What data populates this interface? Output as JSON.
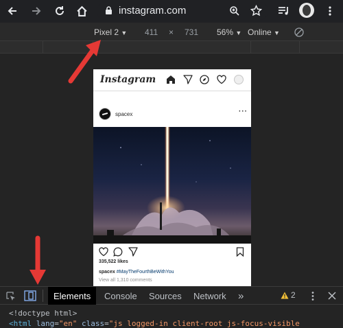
{
  "browser": {
    "url": "instagram.com",
    "colors": {
      "toolbar_bg": "#202124",
      "text": "#e8eaed"
    }
  },
  "device_toolbar": {
    "device": "Pixel 2",
    "width": "411",
    "separator": "×",
    "height": "731",
    "zoom": "56%",
    "network": "Online"
  },
  "instagram": {
    "logo": "Instagram",
    "post": {
      "username": "spacex",
      "more": "···",
      "likes": "335,522 likes",
      "caption_user": "spacex",
      "caption_tag": "#MayTheFourthBeWithYou",
      "comments": "View all 1,310 comments"
    }
  },
  "devtools": {
    "tabs": [
      "Elements",
      "Console",
      "Sources",
      "Network"
    ],
    "more_tabs": "»",
    "warning_count": "2",
    "code_line_1": "<!doctype html>",
    "code_line_2": {
      "tag_open": "<html",
      "attr1": "lang",
      "val1": "\"en\"",
      "attr2": "class",
      "val2": "\"js logged-in client-root js-focus-visible"
    }
  },
  "annotation_color": "#e53935"
}
